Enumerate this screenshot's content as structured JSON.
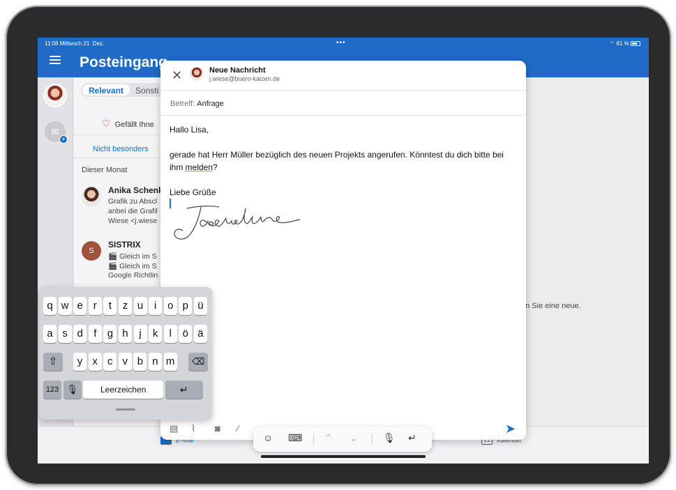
{
  "status": {
    "time": "11:08",
    "date": "Mittwoch 21. Dez.",
    "dots": "•••",
    "battery": "61 %"
  },
  "header": {
    "title": "Posteingang"
  },
  "list": {
    "tabs": [
      {
        "label": "Relevant"
      },
      {
        "label": "Sonsti"
      }
    ],
    "like_prompt": "Gefällt Ihne",
    "not_special": "Nicht besonders",
    "section": "Dieser Monat",
    "mails": [
      {
        "sender": "Anika Schenk",
        "line1": "Grafik zu Abscl",
        "line2": "anbei die Grafil",
        "line3": "Wiese <j.wiese"
      },
      {
        "sender": "SISTRIX",
        "initial": "S",
        "line1": "🎬 Gleich im S",
        "line2": "🎬 Gleich im S",
        "line3": "Google Richtlin"
      }
    ]
  },
  "right_hint": "en Sie eine neue.",
  "bottom": {
    "mail": "E-Mail",
    "calendar_day": "21",
    "calendar": "Kalender"
  },
  "compose": {
    "title": "Neue Nachricht",
    "from": "j.wiese@buero-kaizen.de",
    "subject_label": "Betreff:",
    "subject": "Anfrage",
    "greeting": "Hallo Lisa,",
    "body_part1": "gerade hat Herr Müller bezüglich des neuen Projekts angerufen. Könntest du dich bitte bei ihm ",
    "body_underlined": "melden",
    "body_part2": "?",
    "closing": "Liebe Grüße",
    "signature": "Jacqueline"
  },
  "keyboard": {
    "row1": [
      "q",
      "w",
      "e",
      "r",
      "t",
      "z",
      "u",
      "i",
      "o",
      "p",
      "ü"
    ],
    "row2": [
      "a",
      "s",
      "d",
      "f",
      "g",
      "h",
      "j",
      "k",
      "l",
      "ö",
      "ä"
    ],
    "row3": [
      "y",
      "x",
      "c",
      "v",
      "b",
      "n",
      "m"
    ],
    "numbers": "123",
    "space": "Leerzeichen"
  }
}
